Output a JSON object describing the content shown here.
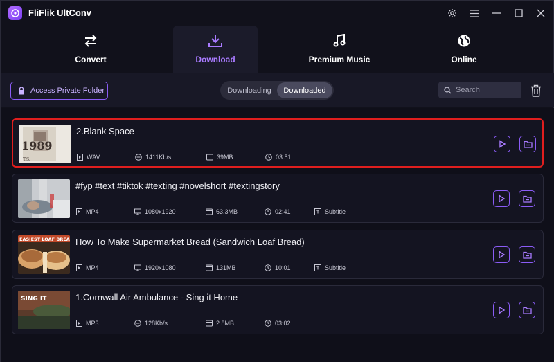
{
  "app": {
    "title": "FliFlik UltConv"
  },
  "tabs": [
    {
      "label": "Convert",
      "icon": "convert-arrows-icon"
    },
    {
      "label": "Download",
      "icon": "download-icon"
    },
    {
      "label": "Premium Music",
      "icon": "music-note-icon"
    },
    {
      "label": "Online",
      "icon": "globe-icon"
    }
  ],
  "active_tab": "Download",
  "toolbar": {
    "private_folder_label": "Access Private Folder",
    "segment": {
      "downloading": "Downloading",
      "downloaded": "Downloaded",
      "selected": "Downloaded"
    },
    "search_placeholder": "Search"
  },
  "items": [
    {
      "title": "2.Blank Space",
      "format": "WAV",
      "quality": "1411Kb/s",
      "size": "39MB",
      "duration": "03:51",
      "subtitle": "",
      "thumb_text": "1989",
      "thumb_caption": "T.S.",
      "highlighted": true
    },
    {
      "title": "#fyp #text #tiktok #texting #novelshort #textingstory",
      "format": "MP4",
      "quality": "1080x1920",
      "size": "63.3MB",
      "duration": "02:41",
      "subtitle": "Subtitle",
      "thumb_text": "",
      "highlighted": false
    },
    {
      "title": "How To Make Supermarket Bread (Sandwich Loaf Bread)",
      "format": "MP4",
      "quality": "1920x1080",
      "size": "131MB",
      "duration": "10:01",
      "subtitle": "Subtitle",
      "thumb_text": "EASIEST LOAF BREAD",
      "highlighted": false
    },
    {
      "title": "1.Cornwall Air Ambulance - Sing it Home",
      "format": "MP3",
      "quality": "128Kb/s",
      "size": "2.8MB",
      "duration": "03:02",
      "subtitle": "",
      "thumb_text": "SING IT",
      "highlighted": false
    }
  ],
  "colors": {
    "accent": "#8b5cf6",
    "highlight_border": "#e01e1e",
    "background": "#11111b"
  }
}
